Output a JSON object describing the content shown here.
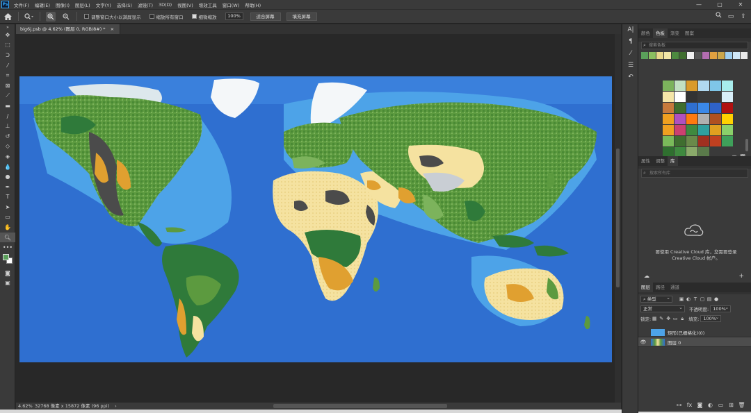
{
  "app": {
    "logo": "Ps"
  },
  "menu": [
    "文件(F)",
    "编辑(E)",
    "图像(I)",
    "图层(L)",
    "文字(Y)",
    "选择(S)",
    "滤镜(T)",
    "3D(D)",
    "视图(V)",
    "增效工具",
    "窗口(W)",
    "帮助(H)"
  ],
  "window_controls": {
    "minimize": "—",
    "maximize": "▢",
    "close": "✕"
  },
  "options": {
    "resize_windows": "调整窗口大小以满屏显示",
    "zoom_all": "缩放所有窗口",
    "scrubby_zoom": "细微缩放",
    "zoom_value": "100%",
    "fit_screen": "适合屏幕",
    "fill_screen": "填充屏幕"
  },
  "document": {
    "tab_title": "big6j.psb @ 4.62% (图层 0, RGB/8#) *",
    "close": "×",
    "zoom": "4.62%",
    "info": "32768 像素 x 15872 像素 (96 ppi)",
    "arrow": "›"
  },
  "swatches_panel": {
    "tabs": [
      "颜色",
      "色板",
      "渐变",
      "图案"
    ],
    "active": 1,
    "search_placeholder": "搜索色板",
    "recent": [
      "#5aa05a",
      "#8bbf5f",
      "#e9d88a",
      "#f2e6a6",
      "#4d8a3f",
      "#3f6e2f",
      "#f0f0f0",
      "#555555",
      "#b36db0",
      "#e0a040",
      "#caa64a",
      "#9fcff0",
      "#cfe8f8",
      "#e8e8e8"
    ],
    "grid": [
      "#7cb35c",
      "#c2e0c2",
      "#d99a2b",
      "#b0d8f0",
      "#7fc6e8",
      "#a8ecec",
      "#f5e6a8",
      "#ffffff",
      "#333333",
      "#3a3a3a",
      "#3a3a3a",
      "#d8eef8",
      "#c77a3c",
      "#3f6e2f",
      "#2f6fd0",
      "#3a88e8",
      "#2f62c8",
      "#b01010",
      "#f0a020",
      "#b050c0",
      "#ff7a10",
      "#b0b0b0",
      "#b05020",
      "#ffd000",
      "#f0a020",
      "#cc4070",
      "#3f8a3f",
      "#30a0a0",
      "#e0a020",
      "#8ad06a",
      "#7aba5a",
      "#3f6e2f",
      "#6a8a4a",
      "#a03020",
      "#c04020",
      "#3fa05a",
      "#2f6f2f",
      "#3f8a3f",
      "#8aaa6a",
      "#5a7a4a"
    ],
    "footer_icons": [
      "folder-icon",
      "new-swatch-icon",
      "trash-icon"
    ]
  },
  "library_panel": {
    "tabs": [
      "属性",
      "调整",
      "库"
    ],
    "active": 2,
    "search_placeholder": "搜索所有库",
    "message": "要使用 Creative Cloud 库，您需要登录 Creative Cloud 帐户。"
  },
  "layers_panel": {
    "tabs": [
      "图层",
      "路径",
      "通道"
    ],
    "active": 0,
    "filter_kind": "类型",
    "blend_mode": "正常",
    "opacity_label": "不透明度:",
    "opacity_value": "100%",
    "lock_label": "锁定:",
    "fill_label": "填充:",
    "fill_value": "100%",
    "layers": [
      {
        "name": "矩形(已栅格化)(0)",
        "visible": false,
        "selected": false,
        "thumb": "#4da3e8"
      },
      {
        "name": "图层 0",
        "visible": true,
        "selected": true,
        "thumb": "#2f6fd0"
      }
    ],
    "footer_icons": [
      "link-icon",
      "fx-icon",
      "mask-icon",
      "adjustment-icon",
      "group-icon",
      "new-layer-icon",
      "trash-icon"
    ]
  },
  "colors": {
    "ui_bg": "#3a3a3a",
    "canvas_bg": "#282828",
    "ocean": "#2f6fd0",
    "fg_color": "#5aa05a",
    "bg_color": "#ffffff"
  }
}
